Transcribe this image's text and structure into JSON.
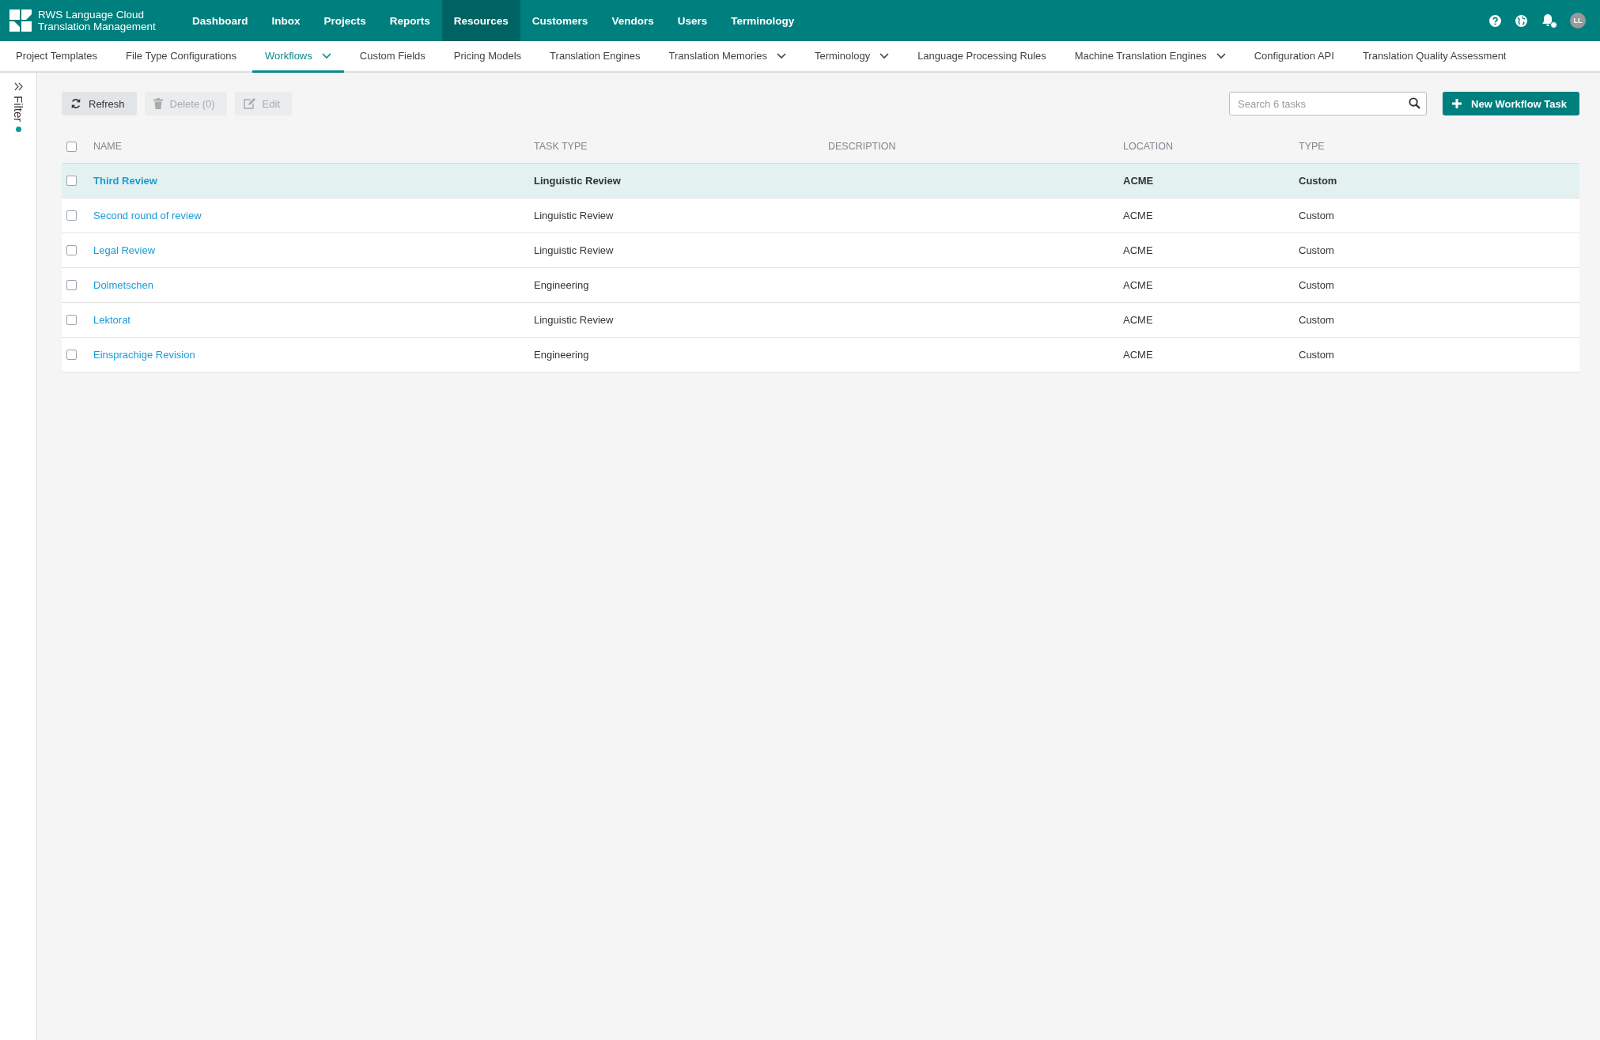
{
  "brand": {
    "line1": "RWS Language Cloud",
    "line2": "Translation Management"
  },
  "nav": [
    {
      "label": "Dashboard",
      "selected": false
    },
    {
      "label": "Inbox",
      "selected": false
    },
    {
      "label": "Projects",
      "selected": false
    },
    {
      "label": "Reports",
      "selected": false
    },
    {
      "label": "Resources",
      "selected": true
    },
    {
      "label": "Customers",
      "selected": false
    },
    {
      "label": "Vendors",
      "selected": false
    },
    {
      "label": "Users",
      "selected": false
    },
    {
      "label": "Terminology",
      "selected": false
    }
  ],
  "user": {
    "initials": "LL",
    "notification": true
  },
  "subnav": [
    {
      "label": "Project Templates",
      "selected": false,
      "dropdown": false
    },
    {
      "label": "File Type Configurations",
      "selected": false,
      "dropdown": false
    },
    {
      "label": "Workflows",
      "selected": true,
      "dropdown": true
    },
    {
      "label": "Custom Fields",
      "selected": false,
      "dropdown": false
    },
    {
      "label": "Pricing Models",
      "selected": false,
      "dropdown": false
    },
    {
      "label": "Translation Engines",
      "selected": false,
      "dropdown": false
    },
    {
      "label": "Translation Memories",
      "selected": false,
      "dropdown": true
    },
    {
      "label": "Terminology",
      "selected": false,
      "dropdown": true
    },
    {
      "label": "Language Processing Rules",
      "selected": false,
      "dropdown": false
    },
    {
      "label": "Machine Translation Engines",
      "selected": false,
      "dropdown": true
    },
    {
      "label": "Configuration API",
      "selected": false,
      "dropdown": false
    },
    {
      "label": "Translation Quality Assessment",
      "selected": false,
      "dropdown": false
    }
  ],
  "filter": {
    "label": "Filter",
    "active": true
  },
  "toolbar": [
    {
      "kind": "refresh",
      "label": "Refresh",
      "disabled": false
    },
    {
      "kind": "delete",
      "label": "Delete (0)",
      "disabled": true
    },
    {
      "kind": "edit",
      "label": "Edit",
      "disabled": true
    }
  ],
  "search": {
    "placeholder": "Search 6 tasks"
  },
  "new_button": "New Workflow Task",
  "table": {
    "select_all_checked": false,
    "columns": [
      "NAME",
      "TASK TYPE",
      "DESCRIPTION",
      "LOCATION",
      "TYPE"
    ],
    "rows": [
      {
        "name": "Third Review",
        "task_type": "Linguistic Review",
        "location": "ACME",
        "type": "Custom",
        "selected": true,
        "checked": false
      },
      {
        "name": "Second round of review",
        "task_type": "Linguistic Review",
        "location": "ACME",
        "type": "Custom",
        "selected": false,
        "checked": false
      },
      {
        "name": "Legal Review",
        "task_type": "Linguistic Review",
        "location": "ACME",
        "type": "Custom",
        "selected": false,
        "checked": false
      },
      {
        "name": "Dolmetschen",
        "task_type": "Engineering",
        "location": "ACME",
        "type": "Custom",
        "selected": false,
        "checked": false
      },
      {
        "name": "Lektorat",
        "task_type": "Linguistic Review",
        "location": "ACME",
        "type": "Custom",
        "selected": false,
        "checked": false
      },
      {
        "name": "Einsprachige Revision",
        "task_type": "Engineering",
        "location": "ACME",
        "type": "Custom",
        "selected": false,
        "checked": false
      }
    ]
  }
}
